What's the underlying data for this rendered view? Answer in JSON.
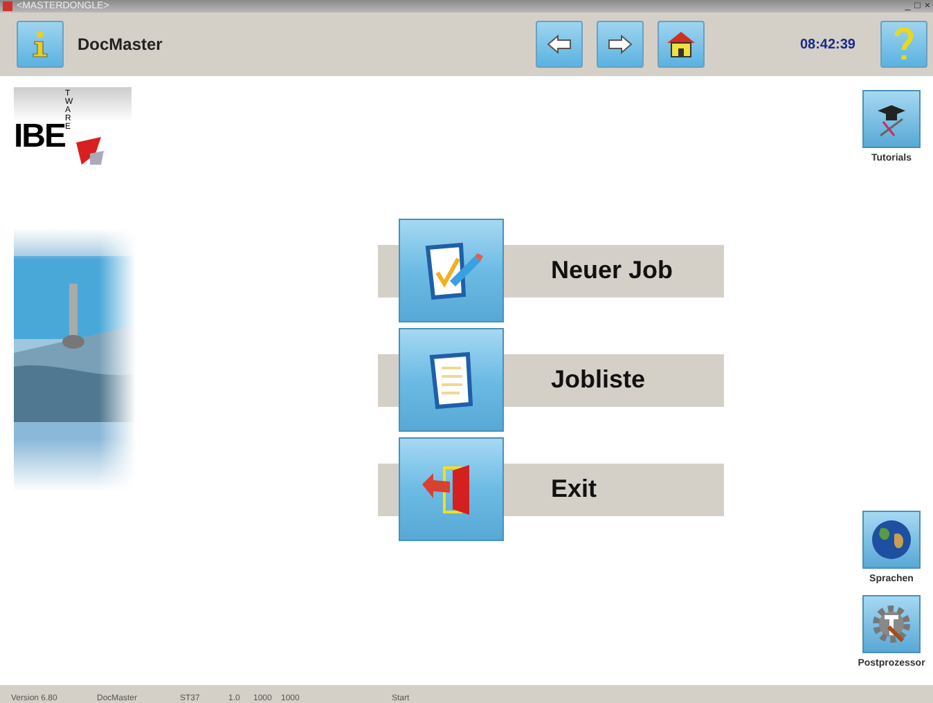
{
  "window": {
    "title": "<MASTERDONGLE>",
    "controls": [
      "_",
      "□",
      "×"
    ]
  },
  "toolbar": {
    "app_name": "DocMaster",
    "time": "08:42:39"
  },
  "logo": {
    "main": "IBE",
    "side": "TWARE"
  },
  "menu": [
    {
      "label": "Neuer Job",
      "kind": "new"
    },
    {
      "label": "Jobliste",
      "kind": "list"
    },
    {
      "label": "Exit",
      "kind": "exit"
    }
  ],
  "side_buttons": [
    {
      "label": "Tutorials",
      "kind": "tutorial"
    },
    {
      "label": "Sprachen",
      "kind": "globe"
    },
    {
      "label": "Postprozessor",
      "kind": "gear"
    }
  ],
  "status_bar": [
    "Version 6.80",
    "DocMaster",
    "ST37",
    "1.0",
    "1000",
    "1000",
    "Start"
  ]
}
